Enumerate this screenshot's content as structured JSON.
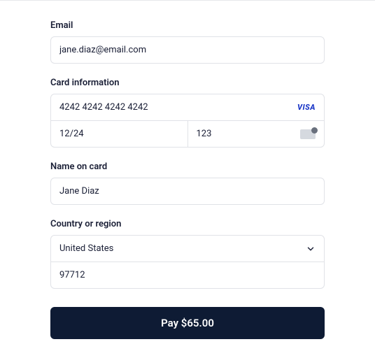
{
  "email": {
    "label": "Email",
    "value": "jane.diaz@email.com"
  },
  "card": {
    "label": "Card information",
    "number": "4242 4242 4242 4242",
    "brand_icon": "visa-icon",
    "brand_text": "VISA",
    "expiry": "12/24",
    "cvc": "123"
  },
  "name": {
    "label": "Name on card",
    "value": "Jane Diaz"
  },
  "country": {
    "label": "Country or region",
    "selected": "United States",
    "postal": "97712"
  },
  "pay_button": "Pay $65.00"
}
